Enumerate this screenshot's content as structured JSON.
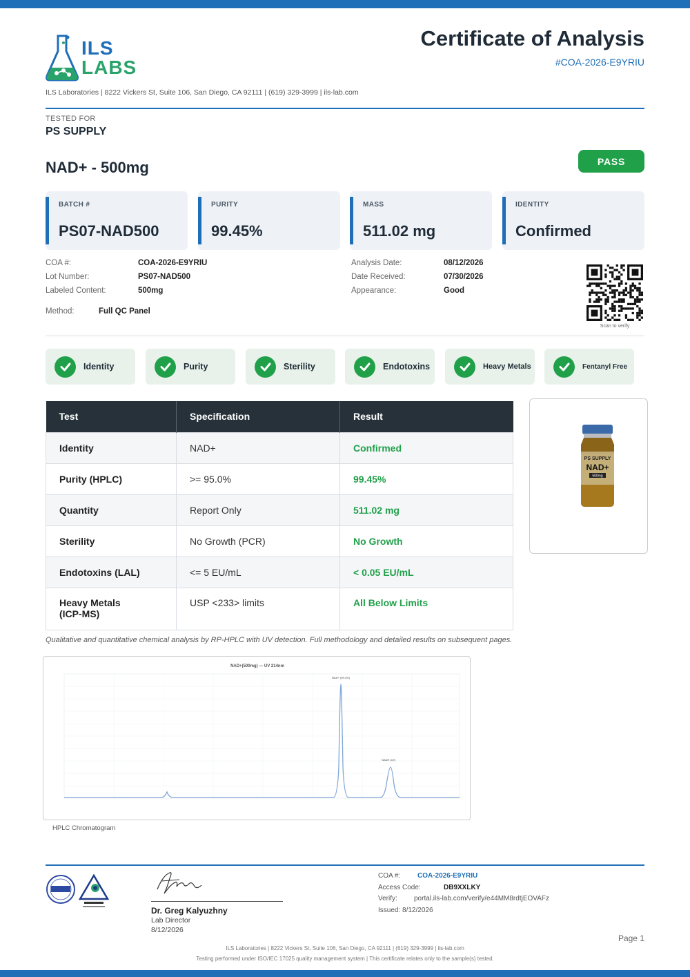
{
  "header": {
    "logo_line1": "ILS",
    "logo_line2": "LABS",
    "title": "Certificate of Analysis",
    "coa_id": "#COA-2026-E9YRIU",
    "address": "ILS Laboratories  |  8222 Vickers St, Suite 106, San Diego, CA 92111  |  (619) 329-3999  |  ils-lab.com"
  },
  "client": {
    "label": "TESTED FOR",
    "name": "PS SUPPLY"
  },
  "product": {
    "name": "NAD+ - 500mg",
    "status": "PASS"
  },
  "stats": [
    {
      "label": "BATCH #",
      "value": "PS07-NAD500"
    },
    {
      "label": "PURITY",
      "value": "99.45%"
    },
    {
      "label": "MASS",
      "value": "511.02 mg"
    },
    {
      "label": "IDENTITY",
      "value": "Confirmed"
    }
  ],
  "meta_left": [
    {
      "k": "COA #:",
      "v": "COA-2026-E9YRIU"
    },
    {
      "k": "Lot Number:",
      "v": "PS07-NAD500"
    },
    {
      "k": "Labeled Content:",
      "v": "500mg"
    }
  ],
  "method": {
    "k": "Method:",
    "v": "Full QC Panel"
  },
  "meta_right": [
    {
      "k": "Analysis Date:",
      "v": "08/12/2026"
    },
    {
      "k": "Date Received:",
      "v": "07/30/2026"
    },
    {
      "k": "Appearance:",
      "v": "Good"
    }
  ],
  "qr_caption": "Scan to verify",
  "checks": [
    "Identity",
    "Purity",
    "Sterility",
    "Endotoxins",
    "Heavy Metals",
    "Fentanyl Free"
  ],
  "table": {
    "headers": [
      "Test",
      "Specification",
      "Result"
    ],
    "rows": [
      {
        "test": "Identity",
        "spec": "NAD+",
        "result": "Confirmed"
      },
      {
        "test": "Purity (HPLC)",
        "spec": ">= 95.0%",
        "result": "99.45%"
      },
      {
        "test": "Quantity",
        "spec": "Report Only",
        "result": "511.02 mg"
      },
      {
        "test": "Sterility",
        "spec": "No Growth (PCR)",
        "result": "No Growth"
      },
      {
        "test": "Endotoxins (LAL)",
        "spec": "<= 5 EU/mL",
        "result": "< 0.05 EU/mL"
      },
      {
        "test": "Heavy Metals (ICP-MS)",
        "spec": "USP <233> limits",
        "result": "All Below Limits"
      }
    ]
  },
  "vial": {
    "brand": "PS SUPPLY",
    "name": "NAD+",
    "dose": "500mg"
  },
  "note": "Qualitative and quantitative chemical analysis by RP-HPLC with UV detection. Full methodology and detailed results on subsequent pages.",
  "chromatogram": {
    "caption": "HPLC Chromatogram",
    "title": "NAD+(500mg) — UV 214nm",
    "peak1_label": "NAD+ (99.4%)",
    "peak2_label": "NADH (ref)"
  },
  "signature": {
    "name": "Dr. Greg Kalyuzhny",
    "role": "Lab Director",
    "date": "8/12/2026"
  },
  "verify": {
    "coa_k": "COA #:",
    "coa_v": "COA-2026-E9YRIU",
    "code_k": "Access Code:",
    "code_v": "DB9XXLKY",
    "verify_k": "Verify:",
    "verify_v": "portal.ils-lab.com/verify/e44MM8rdtjEOVAFz",
    "issued": "Issued: 8/12/2026"
  },
  "page": "Page 1",
  "footer": {
    "line1": "ILS Laboratories  |  8222 Vickers St, Suite 106, San Diego, CA 92111  |  (619) 329-3999  |  ils-lab.com",
    "line2": "Testing performed under ISO/IEC 17025 quality management system  |  This certificate relates only to the sample(s) tested."
  },
  "colors": {
    "brand_blue": "#1f6fb8",
    "pass_green": "#21a04a",
    "logo_green": "#2aa36a",
    "table_header": "#263139"
  }
}
